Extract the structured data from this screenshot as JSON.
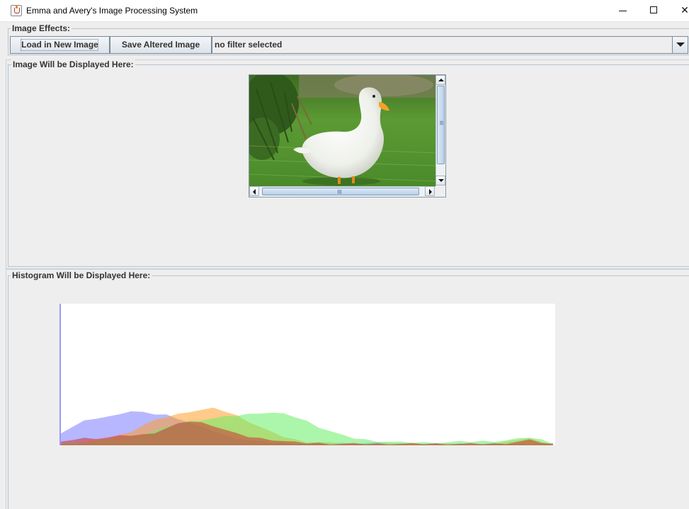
{
  "window": {
    "title": "Emma and Avery's Image Processing System",
    "icon": "java-cup-icon",
    "controls": [
      "minimize",
      "maximize",
      "close"
    ]
  },
  "effects": {
    "section_title": "Image Effects:",
    "load_button": "Load in New Image",
    "save_button": "Save Altered Image",
    "filter_select": {
      "selected": "no filter selected"
    }
  },
  "image_panel": {
    "section_title": "Image Will be Displayed Here:",
    "image_subject": "white duck standing on green grass"
  },
  "histogram": {
    "section_title": "Histogram Will be Displayed Here:"
  },
  "chart_data": {
    "type": "area",
    "title": "",
    "xlabel": "",
    "ylabel": "",
    "x_range": [
      0,
      255
    ],
    "grid": false,
    "legend": "none",
    "series": [
      {
        "color": "#7b7bff",
        "values": [
          18,
          26,
          34,
          38,
          40,
          45,
          48,
          46,
          44,
          43,
          38,
          32,
          26,
          20,
          14,
          10,
          7,
          5,
          4,
          3,
          3,
          3,
          3,
          3,
          3,
          3,
          3,
          3,
          3,
          2,
          2,
          2,
          2,
          2,
          2,
          2,
          2,
          2,
          2,
          2,
          2,
          2,
          2
        ]
      },
      {
        "color": "#ff9f2a",
        "values": [
          2,
          3,
          5,
          7,
          10,
          14,
          20,
          28,
          35,
          40,
          44,
          48,
          50,
          52,
          48,
          42,
          34,
          26,
          18,
          12,
          8,
          5,
          4,
          3,
          2,
          2,
          2,
          2,
          2,
          2,
          2,
          2,
          2,
          2,
          2,
          2,
          2,
          2,
          4,
          8,
          10,
          6,
          2
        ]
      },
      {
        "color": "#66ee66",
        "values": [
          3,
          4,
          5,
          6,
          8,
          10,
          12,
          16,
          20,
          25,
          30,
          34,
          36,
          38,
          40,
          42,
          44,
          46,
          46,
          44,
          40,
          34,
          26,
          20,
          14,
          10,
          8,
          6,
          5,
          4,
          4,
          4,
          4,
          4,
          5,
          5,
          6,
          6,
          7,
          9,
          11,
          8,
          3
        ]
      },
      {
        "color": "#cc3333",
        "values": [
          4,
          8,
          10,
          10,
          11,
          13,
          14,
          15,
          18,
          24,
          30,
          34,
          32,
          28,
          22,
          16,
          12,
          10,
          8,
          6,
          4,
          3,
          3,
          2,
          2,
          2,
          2,
          2,
          2,
          2,
          2,
          2,
          2,
          2,
          2,
          2,
          2,
          2,
          3,
          5,
          7,
          4,
          1
        ]
      }
    ]
  }
}
